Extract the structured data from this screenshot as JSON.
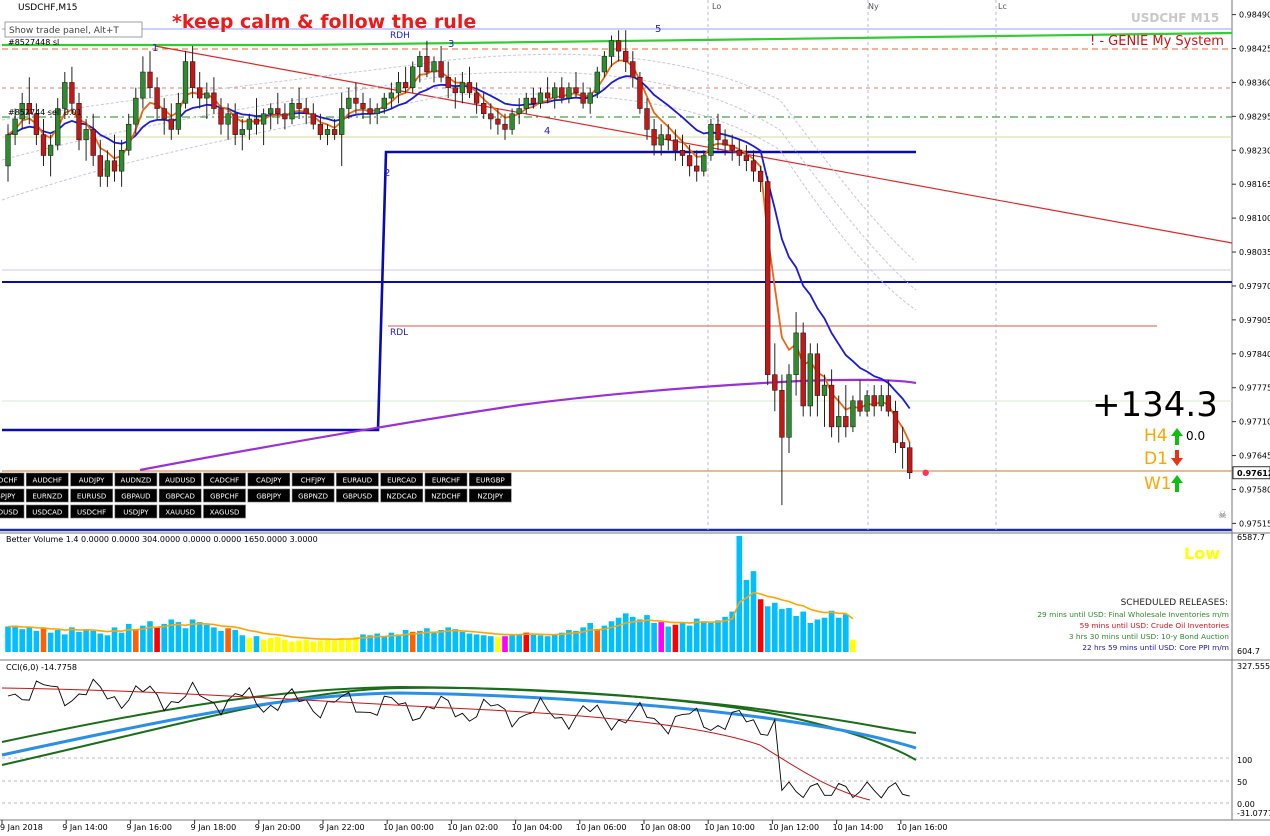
{
  "window": {
    "symbol_title": "USDCHF,M15",
    "trade_panel_hint": "Show trade panel, Alt+T",
    "watermark": "USDCHF M15",
    "banner": "*keep calm & follow the rule",
    "system_label": "! - GENIE My System",
    "order_label_1": "#8527448 sl",
    "order_label_2": "#852744 sell 0.01",
    "session_labels": [
      "Lo",
      "Ny",
      "Lc"
    ]
  },
  "chart_data": [
    {
      "type": "candlestick",
      "title": "USDCHF,M15",
      "x_labels": [
        "9 Jan 2018",
        "9 Jan 14:00",
        "9 Jan 16:00",
        "9 Jan 18:00",
        "9 Jan 20:00",
        "9 Jan 22:00",
        "10 Jan 00:00",
        "10 Jan 02:00",
        "10 Jan 04:00",
        "10 Jan 06:00",
        "10 Jan 08:00",
        "10 Jan 10:00",
        "10 Jan 12:00",
        "10 Jan 14:00",
        "10 Jan 16:00"
      ],
      "price_axis": [
        "0.98490",
        "0.98425",
        "0.98360",
        "0.98295",
        "0.98230",
        "0.98165",
        "0.98100",
        "0.98035",
        "0.97970",
        "0.97905",
        "0.97840",
        "0.97775",
        "0.97710",
        "0.97645",
        "0.97580",
        "0.97515"
      ],
      "ylim": [
        0.975,
        0.985
      ],
      "current_price": "0.97612",
      "levels": [
        {
          "name": "RDH",
          "value": 0.9846
        },
        {
          "name": "RDL",
          "value": 0.9789
        }
      ],
      "wave_labels": [
        "1",
        "2",
        "3",
        "4",
        "5"
      ],
      "candles_ohlc": [
        [
          0.982,
          0.9828,
          0.9817,
          0.9826
        ],
        [
          0.9826,
          0.9831,
          0.9824,
          0.9829
        ],
        [
          0.9829,
          0.9834,
          0.9827,
          0.9832
        ],
        [
          0.9832,
          0.9837,
          0.9828,
          0.983
        ],
        [
          0.983,
          0.9832,
          0.9824,
          0.9826
        ],
        [
          0.9826,
          0.9829,
          0.982,
          0.9822
        ],
        [
          0.9822,
          0.9826,
          0.9818,
          0.9824
        ],
        [
          0.9824,
          0.9833,
          0.9823,
          0.9831
        ],
        [
          0.9831,
          0.9838,
          0.9829,
          0.9836
        ],
        [
          0.9836,
          0.9839,
          0.983,
          0.9832
        ],
        [
          0.9832,
          0.9834,
          0.9823,
          0.9825
        ],
        [
          0.9825,
          0.9829,
          0.9821,
          0.9827
        ],
        [
          0.9827,
          0.983,
          0.982,
          0.9822
        ],
        [
          0.9822,
          0.9825,
          0.9816,
          0.9818
        ],
        [
          0.9818,
          0.9823,
          0.9816,
          0.9821
        ],
        [
          0.9821,
          0.9826,
          0.9817,
          0.9819
        ],
        [
          0.9819,
          0.9825,
          0.9816,
          0.9823
        ],
        [
          0.9823,
          0.983,
          0.9822,
          0.9828
        ],
        [
          0.9828,
          0.9835,
          0.9826,
          0.9833
        ],
        [
          0.9833,
          0.9841,
          0.9831,
          0.9838
        ],
        [
          0.9838,
          0.9842,
          0.9833,
          0.9835
        ],
        [
          0.9835,
          0.9837,
          0.9829,
          0.9831
        ],
        [
          0.9831,
          0.9833,
          0.9826,
          0.9829
        ],
        [
          0.9829,
          0.9832,
          0.9825,
          0.9827
        ],
        [
          0.9827,
          0.9834,
          0.9826,
          0.9832
        ],
        [
          0.9832,
          0.9842,
          0.9831,
          0.984
        ],
        [
          0.984,
          0.9843,
          0.9833,
          0.9835
        ],
        [
          0.9835,
          0.9838,
          0.9831,
          0.9833
        ],
        [
          0.9833,
          0.9836,
          0.9829,
          0.9834
        ],
        [
          0.9834,
          0.9837,
          0.983,
          0.9831
        ],
        [
          0.9831,
          0.9833,
          0.9826,
          0.9828
        ],
        [
          0.9828,
          0.9832,
          0.9825,
          0.983
        ],
        [
          0.983,
          0.9832,
          0.9824,
          0.9826
        ],
        [
          0.9826,
          0.9829,
          0.9823,
          0.9827
        ],
        [
          0.9827,
          0.983,
          0.9825,
          0.9829
        ],
        [
          0.9829,
          0.9833,
          0.9826,
          0.9828
        ],
        [
          0.9828,
          0.9831,
          0.9824,
          0.983
        ],
        [
          0.983,
          0.9832,
          0.9827,
          0.9831
        ],
        [
          0.9831,
          0.9834,
          0.9828,
          0.983
        ],
        [
          0.983,
          0.9832,
          0.9827,
          0.9829
        ],
        [
          0.9829,
          0.9833,
          0.9828,
          0.9832
        ],
        [
          0.9832,
          0.9835,
          0.9829,
          0.9831
        ],
        [
          0.9831,
          0.9833,
          0.9828,
          0.983
        ],
        [
          0.983,
          0.9832,
          0.9827,
          0.9828
        ],
        [
          0.9828,
          0.983,
          0.9825,
          0.9826
        ],
        [
          0.9826,
          0.9828,
          0.9824,
          0.9827
        ],
        [
          0.9827,
          0.9829,
          0.9825,
          0.9826
        ],
        [
          0.9826,
          0.9834,
          0.982,
          0.9831
        ],
        [
          0.9831,
          0.9835,
          0.9829,
          0.9833
        ],
        [
          0.9833,
          0.9836,
          0.983,
          0.9832
        ],
        [
          0.9832,
          0.9834,
          0.9829,
          0.9831
        ],
        [
          0.9831,
          0.9833,
          0.9828,
          0.983
        ],
        [
          0.983,
          0.9832,
          0.9828,
          0.9831
        ],
        [
          0.9831,
          0.9834,
          0.983,
          0.9833
        ],
        [
          0.9833,
          0.9836,
          0.9831,
          0.9834
        ],
        [
          0.9834,
          0.9838,
          0.9832,
          0.9836
        ],
        [
          0.9836,
          0.9839,
          0.9834,
          0.9835
        ],
        [
          0.9835,
          0.984,
          0.9834,
          0.9839
        ],
        [
          0.9839,
          0.9842,
          0.9836,
          0.9841
        ],
        [
          0.9841,
          0.9844,
          0.9837,
          0.9838
        ],
        [
          0.9838,
          0.9841,
          0.9836,
          0.984
        ],
        [
          0.984,
          0.9843,
          0.9836,
          0.9837
        ],
        [
          0.9837,
          0.984,
          0.9833,
          0.9835
        ],
        [
          0.9835,
          0.9837,
          0.9831,
          0.9834
        ],
        [
          0.9834,
          0.9838,
          0.9832,
          0.9836
        ],
        [
          0.9836,
          0.9839,
          0.9833,
          0.9834
        ],
        [
          0.9834,
          0.9836,
          0.983,
          0.9832
        ],
        [
          0.9832,
          0.9834,
          0.9829,
          0.983
        ],
        [
          0.983,
          0.9832,
          0.9827,
          0.9829
        ],
        [
          0.9829,
          0.9831,
          0.9826,
          0.9828
        ],
        [
          0.9828,
          0.983,
          0.9825,
          0.9827
        ],
        [
          0.9827,
          0.9831,
          0.9826,
          0.983
        ],
        [
          0.983,
          0.9833,
          0.9828,
          0.9831
        ],
        [
          0.9831,
          0.9834,
          0.983,
          0.9833
        ],
        [
          0.9833,
          0.9835,
          0.9831,
          0.9832
        ],
        [
          0.9832,
          0.9835,
          0.9831,
          0.9834
        ],
        [
          0.9834,
          0.9837,
          0.9832,
          0.9833
        ],
        [
          0.9833,
          0.9836,
          0.9831,
          0.9835
        ],
        [
          0.9835,
          0.9837,
          0.9832,
          0.9833
        ],
        [
          0.9833,
          0.9836,
          0.9832,
          0.9835
        ],
        [
          0.9835,
          0.9838,
          0.9833,
          0.9834
        ],
        [
          0.9834,
          0.9836,
          0.9831,
          0.9832
        ],
        [
          0.9832,
          0.9835,
          0.983,
          0.9834
        ],
        [
          0.9834,
          0.9839,
          0.9833,
          0.9838
        ],
        [
          0.9838,
          0.9842,
          0.9837,
          0.9841
        ],
        [
          0.9841,
          0.9845,
          0.9839,
          0.9844
        ],
        [
          0.9844,
          0.9846,
          0.984,
          0.9842
        ],
        [
          0.9842,
          0.9846,
          0.9838,
          0.984
        ],
        [
          0.984,
          0.9842,
          0.9835,
          0.9837
        ],
        [
          0.9837,
          0.9838,
          0.983,
          0.9831
        ],
        [
          0.9831,
          0.9833,
          0.9825,
          0.9827
        ],
        [
          0.9827,
          0.9829,
          0.9822,
          0.9824
        ],
        [
          0.9824,
          0.9828,
          0.9822,
          0.9826
        ],
        [
          0.9826,
          0.9828,
          0.9823,
          0.9825
        ],
        [
          0.9825,
          0.9827,
          0.9821,
          0.9823
        ],
        [
          0.9823,
          0.9826,
          0.982,
          0.9822
        ],
        [
          0.9822,
          0.9824,
          0.9818,
          0.982
        ],
        [
          0.982,
          0.9823,
          0.9817,
          0.9819
        ],
        [
          0.9819,
          0.9823,
          0.9818,
          0.9822
        ],
        [
          0.9822,
          0.9829,
          0.9821,
          0.9828
        ],
        [
          0.9828,
          0.983,
          0.9823,
          0.9825
        ],
        [
          0.9825,
          0.9827,
          0.9822,
          0.9824
        ],
        [
          0.9824,
          0.9826,
          0.9821,
          0.9823
        ],
        [
          0.9823,
          0.9825,
          0.982,
          0.9822
        ],
        [
          0.9822,
          0.9824,
          0.9819,
          0.9821
        ],
        [
          0.9821,
          0.9823,
          0.9817,
          0.9819
        ],
        [
          0.9819,
          0.982,
          0.9815,
          0.9817
        ],
        [
          0.9817,
          0.9818,
          0.9778,
          0.978
        ],
        [
          0.978,
          0.9786,
          0.9773,
          0.9777
        ],
        [
          0.9777,
          0.978,
          0.9755,
          0.9768
        ],
        [
          0.9768,
          0.9782,
          0.9765,
          0.978
        ],
        [
          0.978,
          0.9792,
          0.9776,
          0.9788
        ],
        [
          0.9788,
          0.979,
          0.9772,
          0.9774
        ],
        [
          0.9774,
          0.9786,
          0.9772,
          0.9784
        ],
        [
          0.9784,
          0.9786,
          0.9772,
          0.9776
        ],
        [
          0.9776,
          0.978,
          0.977,
          0.9778
        ],
        [
          0.9778,
          0.9781,
          0.9768,
          0.977
        ],
        [
          0.977,
          0.9776,
          0.9767,
          0.9772
        ],
        [
          0.9772,
          0.9778,
          0.9768,
          0.977
        ],
        [
          0.977,
          0.9776,
          0.9769,
          0.9775
        ],
        [
          0.9775,
          0.9779,
          0.9772,
          0.9773
        ],
        [
          0.9773,
          0.9777,
          0.9772,
          0.9776
        ],
        [
          0.9776,
          0.9778,
          0.9772,
          0.9774
        ],
        [
          0.9774,
          0.9778,
          0.9773,
          0.9776
        ],
        [
          0.9776,
          0.9779,
          0.9772,
          0.9773
        ],
        [
          0.9773,
          0.9775,
          0.9765,
          0.9767
        ],
        [
          0.9767,
          0.977,
          0.9762,
          0.9766
        ],
        [
          0.9766,
          0.9767,
          0.976,
          0.97612
        ]
      ],
      "indicators": [
        "MA blue",
        "MA orange",
        "MA purple",
        "envelope bands",
        "trendline red"
      ],
      "pairs": [
        "CADCHF",
        "AUDCHF",
        "AUDJPY",
        "AUDNZD",
        "AUDUSD",
        "CADCHF",
        "CADJPY",
        "CHFJPY",
        "EURAUD",
        "EURCAD",
        "EURCHF",
        "EURGBP",
        "GBPJPY",
        "EURNZD",
        "EURUSD",
        "GBPAUD",
        "GBPCAD",
        "GBPCHF",
        "GBPJPY",
        "GBPNZD",
        "GBPUSD",
        "NZDCAD",
        "NZDCHF",
        "NZDJPY",
        "AUDUSD",
        "USDCAD",
        "USDCHF",
        "USDJPY",
        "XAUUSD",
        "XAGUSD"
      ],
      "selected_pair": "USDCHF",
      "pnl": "+134.3",
      "timeframes": [
        {
          "label": "H4",
          "direction": "up",
          "color": "#ffa500"
        },
        {
          "label": "D1",
          "direction": "down",
          "color": "#ffa500"
        },
        {
          "label": "W1",
          "direction": "up",
          "color": "#ffa500"
        }
      ],
      "h4_value": "0.0"
    },
    {
      "type": "bar",
      "title": "Better Volume 1.4 0.0000 0.0000 304.0000 0.0000 0.0000 1650.0000 3.0000",
      "y_top_label": "6587.7",
      "y_bottom_label": "604.7",
      "status": "Low",
      "releases_title": "SCHEDULED RELEASES:",
      "releases": [
        {
          "text": "29 mins until USD: Final Wholesale Inventories m/m",
          "color": "#2e8b2e"
        },
        {
          "text": "59 mins until USD: Crude Oil Inventories",
          "color": "#d8141e"
        },
        {
          "text": "3 hrs 30 mins until USD: 10-y Bond Auction",
          "color": "#2e8b2e"
        },
        {
          "text": "22 hrs 59 mins until USD: Core PPI m/m",
          "color": "#1a1aaa"
        }
      ],
      "values": [
        1450,
        1500,
        1300,
        1400,
        1200,
        1350,
        1100,
        1250,
        1000,
        1400,
        1150,
        1300,
        1200,
        1050,
        950,
        1400,
        1100,
        1600,
        1250,
        1500,
        1750,
        1450,
        1600,
        1850,
        1700,
        1350,
        1850,
        1700,
        1550,
        1400,
        1200,
        1350,
        1250,
        950,
        800,
        900,
        700,
        800,
        850,
        700,
        600,
        650,
        700,
        600,
        650,
        750,
        650,
        800,
        750,
        850,
        1000,
        950,
        1050,
        900,
        1100,
        1000,
        1250,
        1150,
        1200,
        1350,
        1100,
        1250,
        1400,
        1300,
        1150,
        1050,
        1000,
        950,
        900,
        850,
        900,
        950,
        1000,
        1100,
        1050,
        950,
        900,
        1000,
        1100,
        1250,
        1200,
        1400,
        1650,
        1300,
        1500,
        1750,
        1950,
        2200,
        2000,
        1850,
        2100,
        1650,
        1700,
        1450,
        1550,
        1700,
        1500,
        1900,
        1750,
        1650,
        1800,
        2000,
        2300,
        6600,
        4100,
        4600,
        3000,
        2600,
        2800,
        2450,
        2500,
        2050,
        2300,
        1650,
        1850,
        1950,
        2350,
        1950,
        2150,
        700
      ],
      "colors_legend": [
        "deepskyblue normal",
        "red climax",
        "magenta churn",
        "yellow low",
        "orange/yellow MA"
      ]
    },
    {
      "type": "line",
      "title": "CCI(6,0) -14.7758",
      "y_ticks": [
        "327.555",
        "100",
        "50",
        "0.00",
        "-31.0777"
      ],
      "series": [
        "CCI black",
        "signal red",
        "band dark green",
        "MA blue"
      ]
    }
  ],
  "colors": {
    "bull": "#2e8b2e",
    "bear": "#c21818",
    "ma_blue": "#1b1bdc",
    "ma_orange": "#f06414",
    "ma_purple": "#9b30d9",
    "rd_line": "#0a0ab4",
    "trend": "#e02828",
    "green_line": "#32cd32",
    "vol_normal": "#00bfff",
    "vol_climax": "#ff0000",
    "vol_churn": "#ff00ff",
    "vol_low": "#ffff00",
    "vol_ma": "#ffa500",
    "cci_black": "#000000",
    "cci_red": "#c81414",
    "cci_green": "#1a6e1a",
    "cci_blue": "#2a8fe6"
  }
}
